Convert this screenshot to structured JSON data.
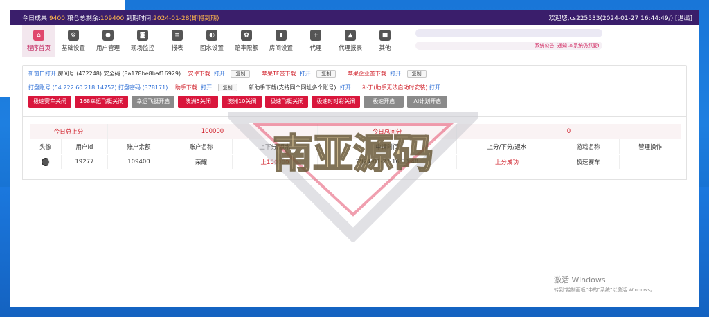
{
  "header": {
    "today_label": "今日成果:",
    "today_value": "9400",
    "grain_label": "粮仓总剩余:",
    "grain_value": "109400",
    "expire_label": "到期时间:",
    "expire_value": "2024-01-28(即将到期)",
    "welcome": "欢迎您,cs225533(2024-01-27 16:44:49/)",
    "logout": "[退出]"
  },
  "nav": {
    "items": [
      {
        "label": "程序首页",
        "icon": "home-icon"
      },
      {
        "label": "基础设置",
        "icon": "gear-icon"
      },
      {
        "label": "用户管理",
        "icon": "user-icon"
      },
      {
        "label": "现场监控",
        "icon": "camera-icon"
      },
      {
        "label": "报表",
        "icon": "report-icon"
      },
      {
        "label": "回水设置",
        "icon": "water-icon"
      },
      {
        "label": "赔率限额",
        "icon": "odds-icon"
      },
      {
        "label": "房间设置",
        "icon": "room-icon"
      },
      {
        "label": "代理",
        "icon": "agent-icon"
      },
      {
        "label": "代理报表",
        "icon": "agent-report-icon"
      },
      {
        "label": "其他",
        "icon": "box-icon"
      }
    ],
    "announcement": "系统公告: 通知 本系统仍然要!"
  },
  "links": {
    "new_window": "新窗口打开",
    "room_info": "房间号:(472248) 安全码:(8a178be8baf16929)",
    "android_label": "安卓下载:",
    "open": "打开",
    "copy": "复制",
    "iphone_tf_label": "苹果TF签下载:",
    "iphone_ent_label": "苹果企业签下载:",
    "score_account": "打盘账号 (54.222.60.218:14752) 打盘密码 (378171)",
    "helper_label": "助手下载:",
    "new_helper_label": "新助手下载(支持同个网址多个账号):",
    "patch_label": "补丁(助手无法启动时安装)"
  },
  "buttons": [
    {
      "label": "极速赛车关闭",
      "color": "red"
    },
    {
      "label": "168幸运飞艇关闭",
      "color": "red"
    },
    {
      "label": "幸运飞艇开启",
      "color": "gray"
    },
    {
      "label": "澳洲5关闭",
      "color": "red"
    },
    {
      "label": "澳洲10关闭",
      "color": "red"
    },
    {
      "label": "极速飞艇关闭",
      "color": "red"
    },
    {
      "label": "极速时时彩关闭",
      "color": "red"
    },
    {
      "label": "极速开启",
      "color": "gray"
    },
    {
      "label": "AI计划开启",
      "color": "gray"
    }
  ],
  "summary": {
    "today_up_label": "今日总上分",
    "today_up_value": "100000",
    "today_back_label": "今日总回分",
    "today_back_value": "0"
  },
  "table": {
    "headers": [
      "头像",
      "用户Id",
      "账户余额",
      "账户名称",
      "上下分/返水",
      "申请时间",
      "上分/下分/返水",
      "游戏名称",
      "管理操作"
    ],
    "rows": [
      [
        "",
        "19277",
        "109400",
        "荣耀",
        "上100000",
        "2024-01-27 16:33:48",
        "上分成功",
        "极速赛车",
        ""
      ]
    ]
  },
  "watermark": "南亚源码",
  "windows_activation": {
    "title": "激活 Windows",
    "subtitle": "转到“控制面板”中的“系统”以激活 Windows。"
  }
}
